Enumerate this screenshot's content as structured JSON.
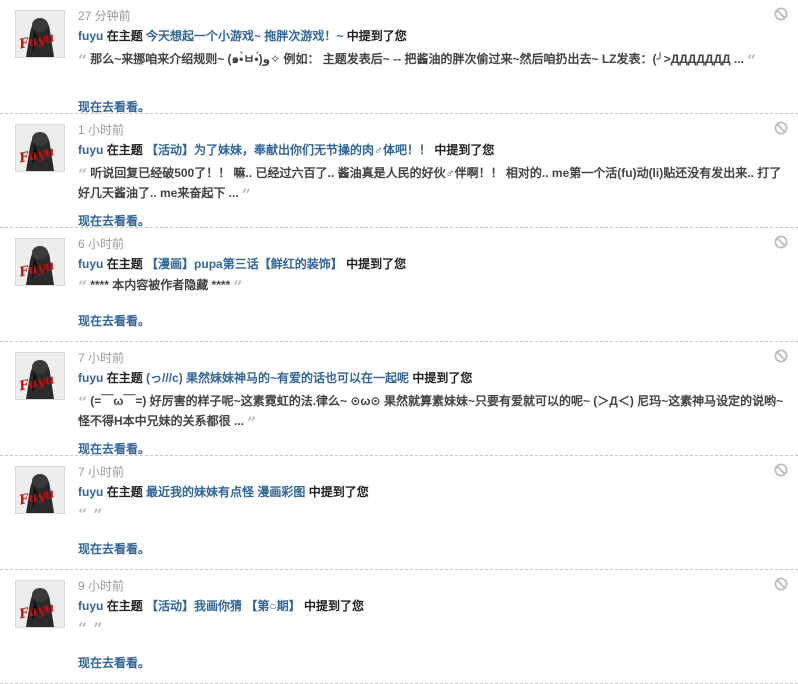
{
  "notifications": [
    {
      "time": "27 分钟前",
      "user": "fuyu",
      "in_topic": "在主题",
      "topic": "今天想起一个小游戏~ 拖胖次游戏！~",
      "mentioned": "中提到了您",
      "quote": "那么~来挪咱来介绍规则~ (๑•̀ㅂ•́)و✧ 例如： 主题发表后~ -- 把酱油的胖次偷过来~然后咱扔出去~ LZ发表：(╯>ДДДДДДД ...",
      "more": "现在去看看。"
    },
    {
      "time": "1 小时前",
      "user": "fuyu",
      "in_topic": "在主题",
      "topic": "【活动】为了妹妹，奉献出你们无节操的肉♂体吧！！",
      "mentioned": "中提到了您",
      "quote": "听说回复已经破500了！！ 嘛.. 已经过六百了.. 酱油真是人民的好伙♂伴啊！！ 相对的.. me第一个活(fu)动(li)贴还没有发出来.. 打了好几天酱油了.. me来奋起下 ...",
      "more": "现在去看看。"
    },
    {
      "time": "6 小时前",
      "user": "fuyu",
      "in_topic": "在主题",
      "topic": "【漫画】pupa第三话【鲜红的装饰】",
      "mentioned": "中提到了您",
      "quote": "**** 本内容被作者隐藏 ****",
      "more": "现在去看看。"
    },
    {
      "time": "7 小时前",
      "user": "fuyu",
      "in_topic": "在主题",
      "topic": "(っ///c) 果然妹妹神马的~有爱的话也可以在一起呢",
      "mentioned": "中提到了您",
      "quote": "(=￣ω￣=) 好厉害的样子呢~这素霓虹的法.律么~ ⊙ω⊙ 果然就算素妹妹~只要有爱就可以的呢~ (＞Д＜) 尼玛~这素神马设定的说哟~怪不得H本中兄妹的关系都很 ...",
      "more": "现在去看看。"
    },
    {
      "time": "7 小时前",
      "user": "fuyu",
      "in_topic": "在主题",
      "topic": "最近我的妹妹有点怪 漫画彩图",
      "mentioned": "中提到了您",
      "quote": "",
      "more": "现在去看看。"
    },
    {
      "time": "9 小时前",
      "user": "fuyu",
      "in_topic": "在主题",
      "topic": "【活动】我画你猜 【第○期】",
      "mentioned": "中提到了您",
      "quote": "",
      "more": "现在去看看。"
    }
  ],
  "avatar_text": "Fuyu",
  "colors": {
    "link": "#336699",
    "time": "#999999",
    "divider": "#c8c8c8"
  },
  "icons": {
    "dismiss": "prohibited-circle-icon",
    "quote_open": "“",
    "quote_close": "”"
  }
}
